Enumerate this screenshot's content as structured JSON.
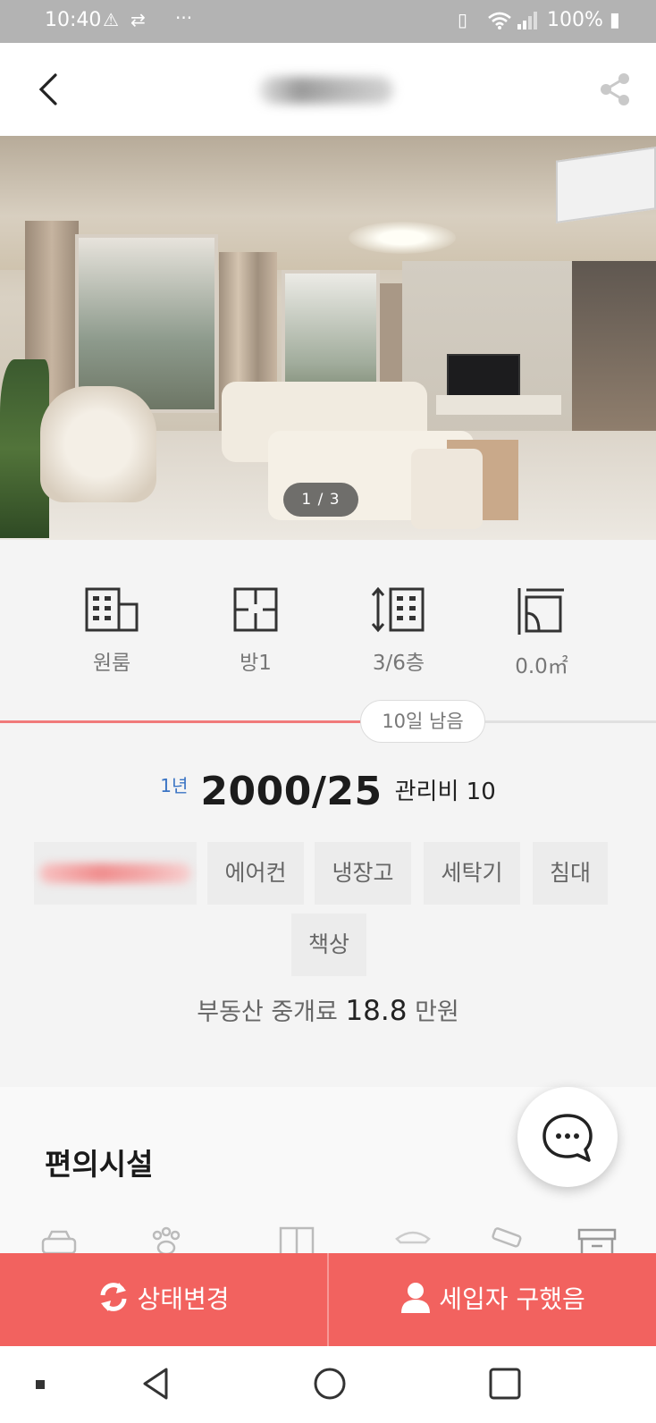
{
  "status_bar": {
    "time": "10:40",
    "battery": "100%",
    "dots": "···"
  },
  "header": {
    "title_redacted": true
  },
  "photo": {
    "counter": "1 / 3"
  },
  "features": [
    {
      "icon": "building-icon",
      "label": "원룸"
    },
    {
      "icon": "floorplan-icon",
      "label": "방1"
    },
    {
      "icon": "floor-height-icon",
      "label": "3/6층"
    },
    {
      "icon": "area-icon",
      "label": "0.0㎡"
    }
  ],
  "listing": {
    "remaining": "10일 남음",
    "remaining_fraction": 0.55,
    "term": "1년",
    "price": "2000/25",
    "management_fee": "관리비 10",
    "options": [
      "에어컨",
      "냉장고",
      "세탁기",
      "침대",
      "책상"
    ],
    "broker_fee_label": "부동산 중개료",
    "broker_fee_amount": "18.8",
    "broker_fee_unit": "만원"
  },
  "facilities": {
    "title": "편의시설"
  },
  "actions": {
    "change_status": "상태변경",
    "tenant_found": "세입자 구했음"
  },
  "colors": {
    "accent": "#f2625f",
    "term_blue": "#3a74c4",
    "progress": "#f07a7a"
  }
}
